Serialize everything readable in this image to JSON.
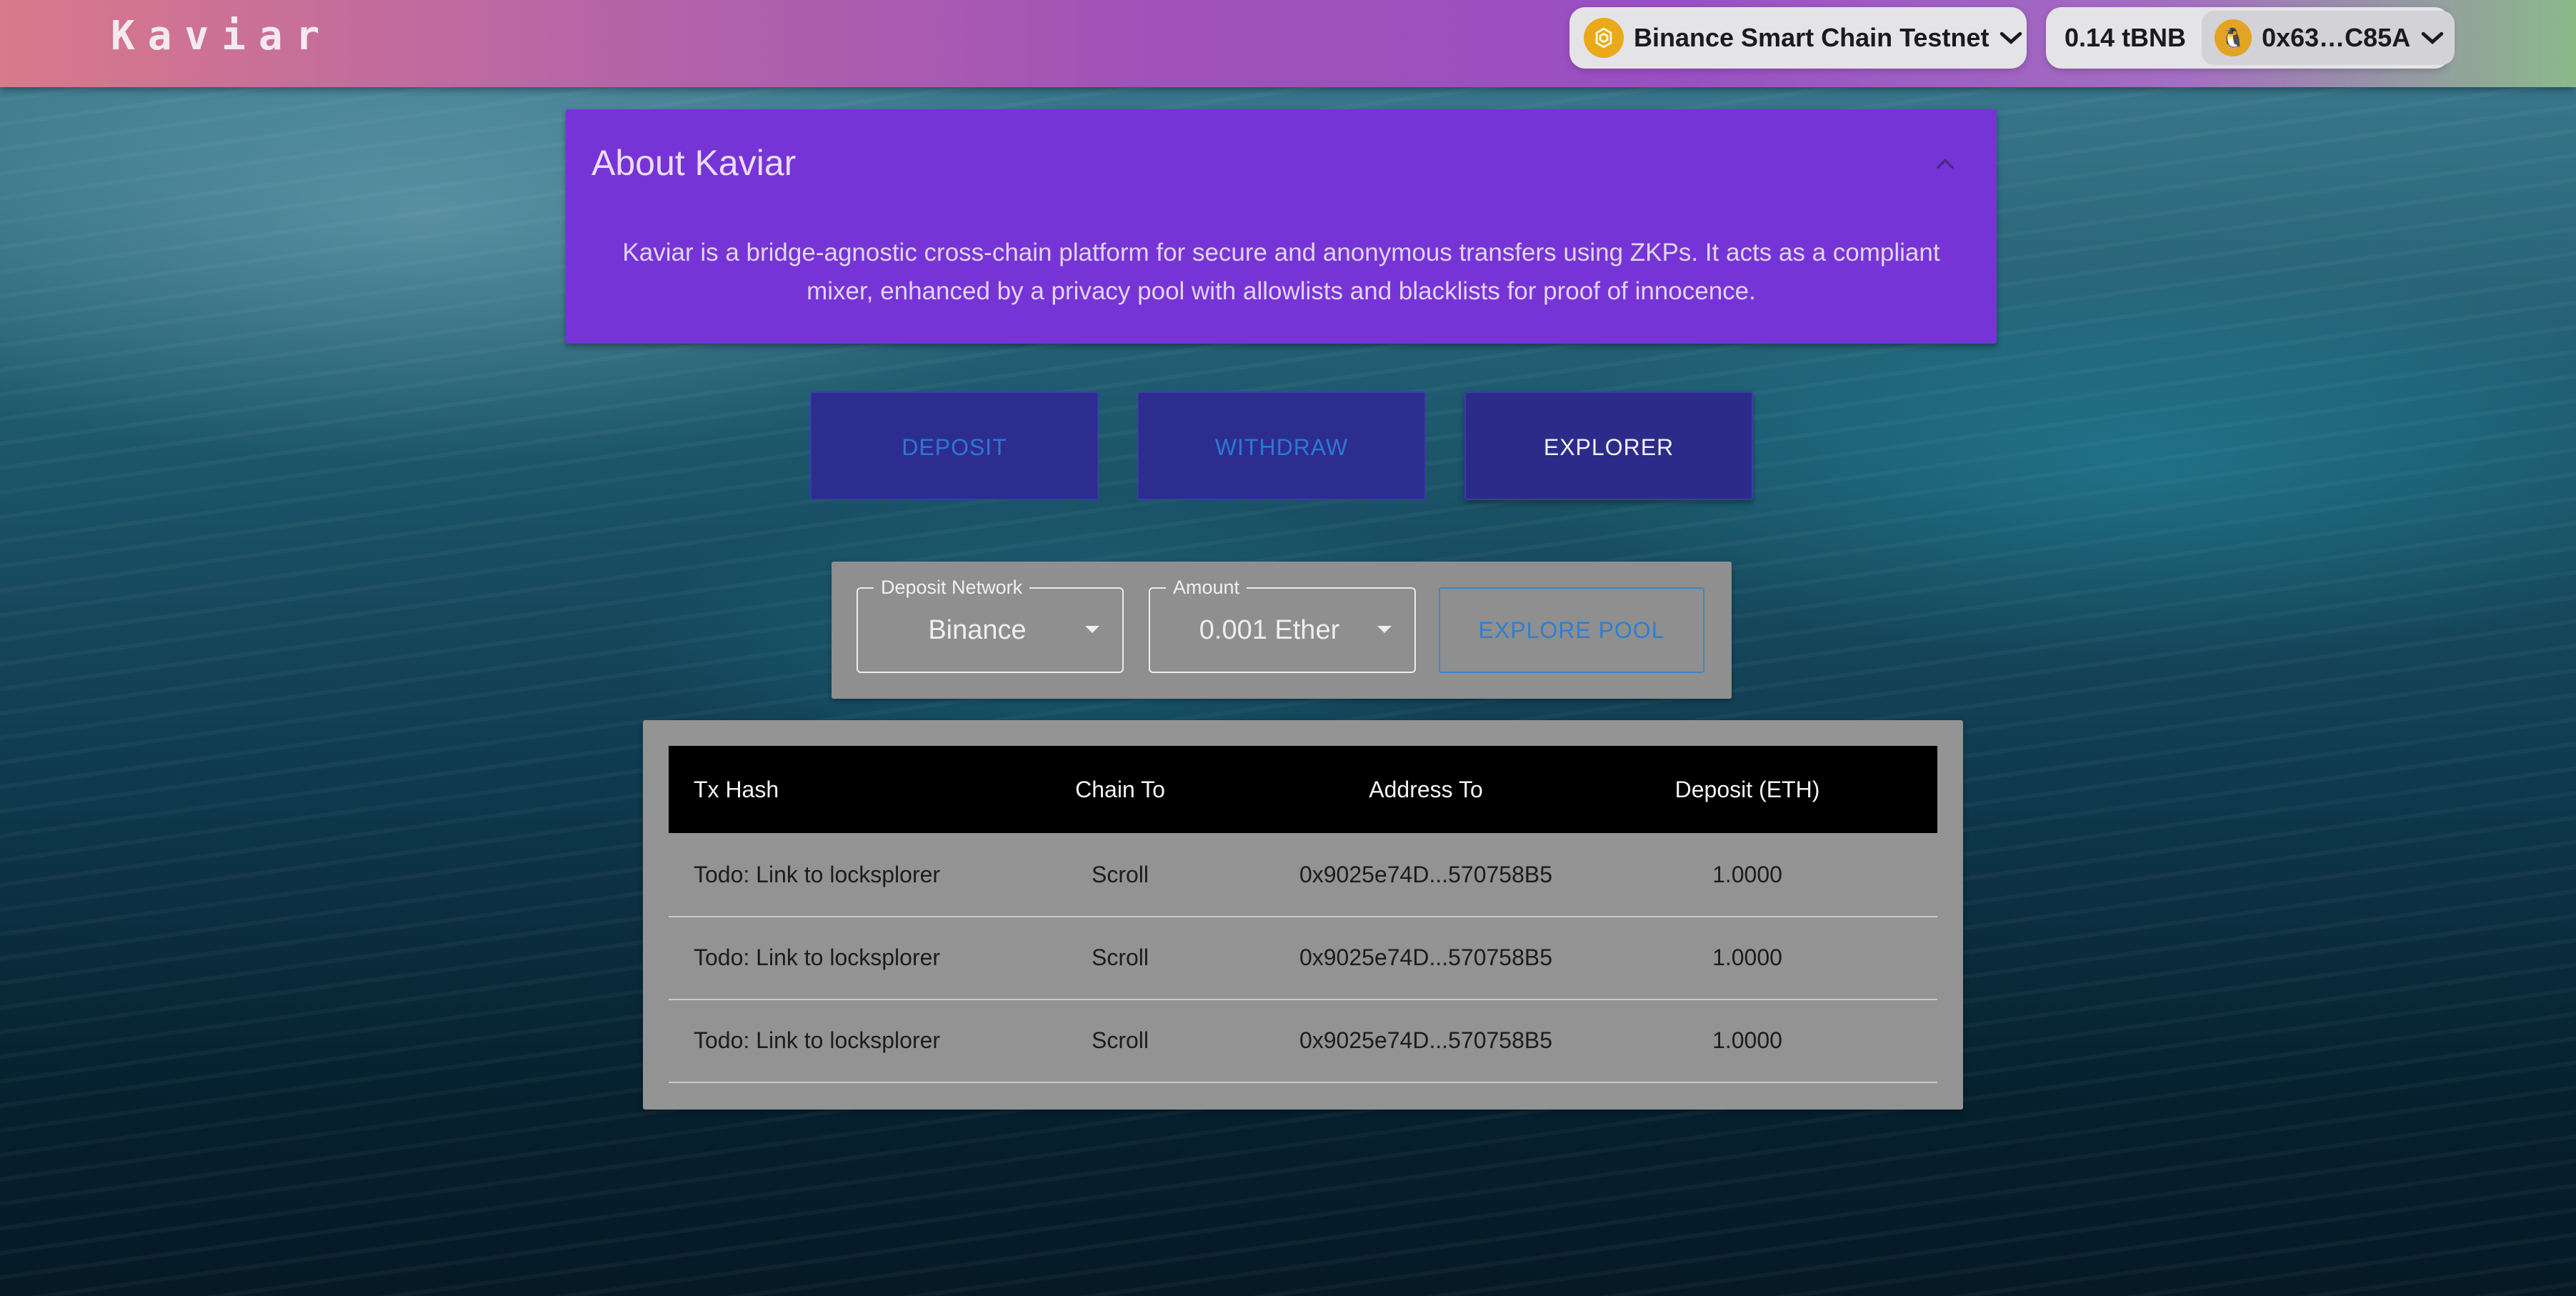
{
  "header": {
    "brand": "Kaviar",
    "network": "Binance Smart Chain Testnet",
    "balance": "0.14 tBNB",
    "address": "0x63…C85A"
  },
  "about": {
    "title": "About Kaviar",
    "body": "Kaviar is a bridge-agnostic cross-chain platform for secure and anonymous transfers using ZKPs. It acts as a compliant mixer, enhanced by a privacy pool with allowlists and blacklists for proof of innocence."
  },
  "modes": {
    "deposit": "DEPOSIT",
    "withdraw": "WITHDRAW",
    "explorer": "EXPLORER",
    "active": "explorer"
  },
  "filters": {
    "network_label": "Deposit Network",
    "network_value": "Binance",
    "amount_label": "Amount",
    "amount_value": "0.001 Ether",
    "explore_button": "EXPLORE POOL"
  },
  "table": {
    "columns": [
      "Tx Hash",
      "Chain To",
      "Address To",
      "Deposit (ETH)"
    ],
    "rows": [
      [
        "Todo: Link to locksplorer",
        "Scroll",
        "0x9025e74D...570758B5",
        "1.0000"
      ],
      [
        "Todo: Link to locksplorer",
        "Scroll",
        "0x9025e74D...570758B5",
        "1.0000"
      ],
      [
        "Todo: Link to locksplorer",
        "Scroll",
        "0x9025e74D...570758B5",
        "1.0000"
      ]
    ]
  },
  "colors": {
    "about_bg": "#7634d6",
    "mode_button_bg": "#2c2d8f",
    "link_blue": "#2c78d4",
    "bnb_yellow": "#e9a91b"
  },
  "icons": {
    "network": "bnb-chain-icon",
    "account": "penguin-avatar-icon",
    "collapse": "chevron-up-icon",
    "dropdown": "caret-down-icon"
  }
}
